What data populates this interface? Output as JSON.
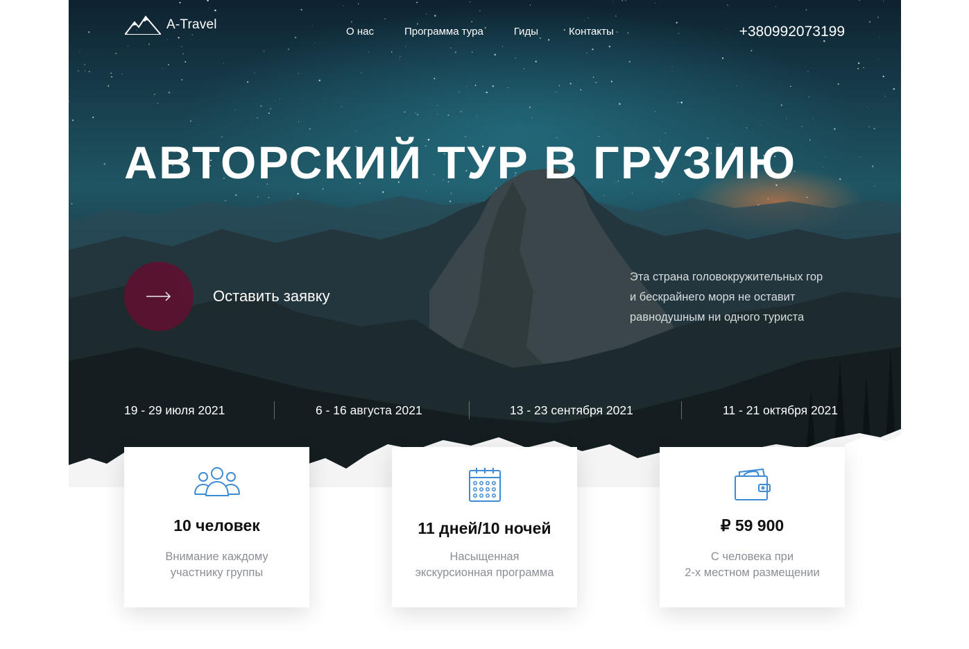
{
  "brand": {
    "name": "A-Travel",
    "logo_icon": "mountain-icon"
  },
  "nav": {
    "items": [
      {
        "label": "О нас"
      },
      {
        "label": "Программа тура"
      },
      {
        "label": "Гиды"
      },
      {
        "label": "Контакты"
      }
    ],
    "phone": "+380992073199"
  },
  "hero": {
    "title": "АВТОРСКИЙ ТУР В ГРУЗИЮ",
    "cta_label": "Оставить заявку",
    "cta_icon": "arrow-right-icon",
    "description": "Эта страна головокружительных гор и бескрайнего моря не оставит равнодушным ни одного туриста",
    "description_lines": [
      "Эта страна головокружительных гор",
      "и бескрайнего моря не оставит",
      "равнодушным ни одного туриста"
    ]
  },
  "dates": [
    "19 - 29 июля 2021",
    "6 - 16 августа 2021",
    "13 - 23 сентября 2021",
    "11 - 21 октября 2021"
  ],
  "features": [
    {
      "icon": "group-icon",
      "value": "10 человек",
      "sub": [
        "Внимание каждому",
        "участнику группы"
      ]
    },
    {
      "icon": "calendar-icon",
      "value": "11 дней/10 ночей",
      "sub": [
        "Насыщенная",
        "экскурсионная программа"
      ]
    },
    {
      "icon": "wallet-icon",
      "value": "₽ 59 900",
      "sub": [
        "С человека при",
        "2-х местном размещении"
      ]
    }
  ],
  "colors": {
    "accent": "#5c1231",
    "icon_blue": "#3d8bd4",
    "text_muted": "#8a8f96"
  }
}
